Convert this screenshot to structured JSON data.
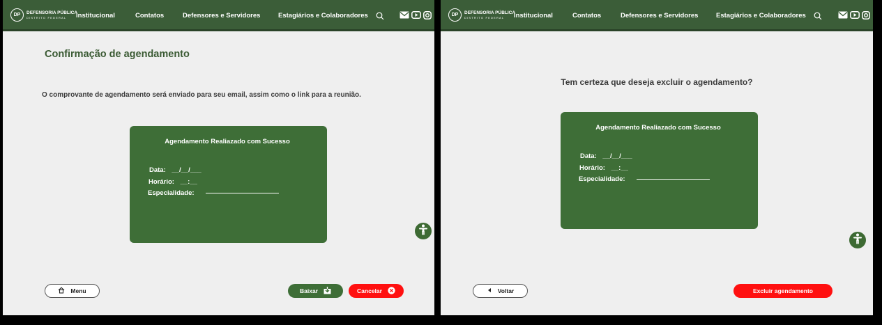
{
  "nav": {
    "logo_line1": "DEFENSORIA PÚBLICA",
    "logo_line2": "DISTRITO FEDERAL",
    "logo_badge": "DP",
    "links": [
      "Institucional",
      "Contatos",
      "Defensores e Servidores",
      "Estagiários e Colaboradores"
    ],
    "icons": [
      "search-icon",
      "mail-icon",
      "youtube-icon",
      "instagram-icon"
    ]
  },
  "confirm_screen": {
    "title": "Confirmação de agendamento",
    "info": "O comprovante de agendamento será enviado para seu email, assim como o link para a reunião.",
    "card": {
      "title": "Agendamento Realiazado com Sucesso",
      "date_label": "Data:",
      "date_value": "__/__/___",
      "time_label": "Horário:",
      "time_value": "__:__",
      "specialty_label": "Especialidade:"
    },
    "menu_button": "Menu",
    "download_button": "Baixar",
    "cancel_button": "Cancelar"
  },
  "delete_screen": {
    "question": "Tem certeza que deseja excluir o agendamento?",
    "card": {
      "title": "Agendamento Realiazado com Sucesso",
      "date_label": "Data:",
      "date_value": "__/__/___",
      "time_label": "Horário:",
      "time_value": "__:__",
      "specialty_label": "Especialidade:"
    },
    "back_button": "Voltar",
    "delete_button": "Excluir agendamento"
  },
  "colors": {
    "brand_green": "#3e6e37",
    "nav_green": "#3b5d38",
    "danger_red": "#ff1010",
    "background": "#efefef"
  }
}
